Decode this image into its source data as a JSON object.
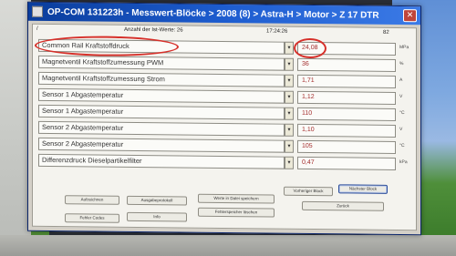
{
  "window": {
    "title": "OP-COM 131223h - Messwert-Blöcke > 2008 (8) > Astra-H > Motor > Z 17 DTR",
    "close_glyph": "✕"
  },
  "info": {
    "left_marker": "/",
    "count_label": "Anzahl der Ist-Werte: 26",
    "time": "17:24:26",
    "right_value": "82"
  },
  "rows": [
    {
      "name": "Common Rail Kraftstoffdruck",
      "value": "24,08",
      "unit": "MPa"
    },
    {
      "name": "Magnetventil Kraftstoffzumessung PWM",
      "value": "36",
      "unit": "%"
    },
    {
      "name": "Magnetventil Kraftstoffzumessung Strom",
      "value": "1,71",
      "unit": "A"
    },
    {
      "name": "Sensor 1 Abgastemperatur",
      "value": "1,12",
      "unit": "V"
    },
    {
      "name": "Sensor 1 Abgastemperatur",
      "value": "110",
      "unit": "°C"
    },
    {
      "name": "Sensor 2 Abgastemperatur",
      "value": "1,10",
      "unit": "V"
    },
    {
      "name": "Sensor 2 Abgastemperatur",
      "value": "105",
      "unit": "°C"
    },
    {
      "name": "Differenzdruck Dieselpartikelfilter",
      "value": "0,47",
      "unit": "kPa"
    }
  ],
  "dropdown_glyph": "▾",
  "buttons": {
    "b1": "Aufzeichnen",
    "b2": "Ausgabeprotokoll",
    "b3": "Werte in Datei speichern",
    "b4": "Vorheriger Block",
    "b5": "Nächster Block",
    "b6": "Fehler Codes",
    "b7": "Info",
    "b8": "Fehlerspeicher löschen",
    "b9": "Zurück"
  },
  "colors": {
    "value_text": "#a32b2b",
    "highlight_circle": "#d6302a",
    "titlebar": "#1d5ccf"
  }
}
